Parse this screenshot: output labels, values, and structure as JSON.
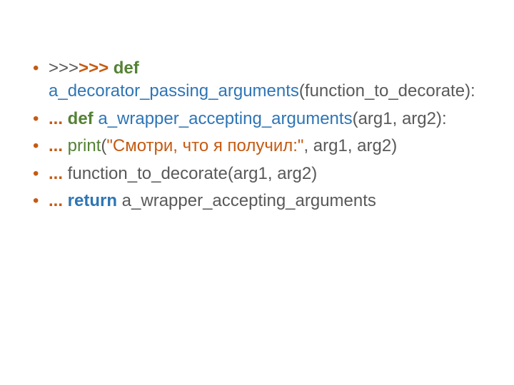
{
  "bullets": [
    {
      "segments": [
        {
          "text": ">>>",
          "cls": "gray"
        },
        {
          "text": ">>> ",
          "cls": "orange-bold"
        },
        {
          "text": "def",
          "cls": "green-bold"
        },
        {
          "text": " a_decorator_passing_arguments",
          "cls": "blue"
        },
        {
          "text": "(function_to_decorate):",
          "cls": "gray"
        }
      ]
    },
    {
      "segments": [
        {
          "text": " ... ",
          "cls": "orange-bold"
        },
        {
          "text": "def",
          "cls": "green-bold"
        },
        {
          "text": " a_wrapper_accepting_arguments",
          "cls": "blue"
        },
        {
          "text": "(arg1, arg2):",
          "cls": "gray"
        }
      ]
    },
    {
      "segments": [
        {
          "text": "... ",
          "cls": "orange-bold"
        },
        {
          "text": "print",
          "cls": "green"
        },
        {
          "text": "(",
          "cls": "gray"
        },
        {
          "text": "\"Смотри, что я получил:\"",
          "cls": "orange"
        },
        {
          "text": ", arg1, arg2)",
          "cls": "gray"
        }
      ]
    },
    {
      "segments": [
        {
          "text": "...",
          "cls": "orange-bold"
        },
        {
          "text": " function_to_decorate(arg1, arg2)",
          "cls": "gray"
        }
      ]
    },
    {
      "segments": [
        {
          "text": "... ",
          "cls": "orange-bold"
        },
        {
          "text": "return",
          "cls": "blue-bold"
        },
        {
          "text": " a_wrapper_accepting_arguments",
          "cls": "gray"
        }
      ]
    }
  ]
}
